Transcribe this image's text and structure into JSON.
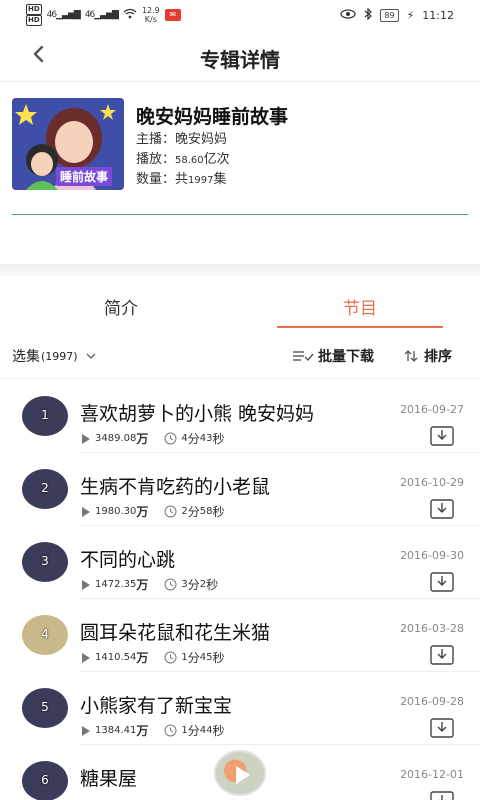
{
  "status_bar": {
    "hd1": "HD",
    "hd2": "HD",
    "signal1": "46",
    "signal2": "46",
    "net_speed": "12.9",
    "net_unit": "K/s",
    "battery": "89",
    "time": "11:12"
  },
  "header": {
    "title": "专辑详情"
  },
  "album": {
    "title": "晚安妈妈睡前故事",
    "cover_label": "睡前故事",
    "host_label": "主播：",
    "host": "晚安妈妈",
    "plays_label": "播放：",
    "plays_num": "58.60",
    "plays_unit": "亿次",
    "count_label": "数量：共",
    "count_num": "1997",
    "count_unit": "集"
  },
  "tabs": {
    "intro": "简介",
    "programs": "节目"
  },
  "toolbar": {
    "select_label": "选集",
    "select_count": "(1997)",
    "batch_label": "批量下载",
    "sort_label": "排序"
  },
  "episodes": [
    {
      "index": "1",
      "title": "喜欢胡萝卜的小熊 晚安妈妈",
      "date": "2016-09-27",
      "plays_num": "3489.08",
      "plays_unit": "万",
      "dur_min": "4",
      "dur_min_unit": "分",
      "dur_sec": "43",
      "dur_sec_unit": "秒"
    },
    {
      "index": "2",
      "title": "生病不肯吃药的小老鼠",
      "date": "2016-10-29",
      "plays_num": "1980.30",
      "plays_unit": "万",
      "dur_min": "2",
      "dur_min_unit": "分",
      "dur_sec": "58",
      "dur_sec_unit": "秒"
    },
    {
      "index": "3",
      "title": "不同的心跳",
      "date": "2016-09-30",
      "plays_num": "1472.35",
      "plays_unit": "万",
      "dur_min": "3",
      "dur_min_unit": "分",
      "dur_sec": "2",
      "dur_sec_unit": "秒"
    },
    {
      "index": "4",
      "title": "圆耳朵花鼠和花生米猫",
      "date": "2016-03-28",
      "plays_num": "1410.54",
      "plays_unit": "万",
      "dur_min": "1",
      "dur_min_unit": "分",
      "dur_sec": "45",
      "dur_sec_unit": "秒"
    },
    {
      "index": "5",
      "title": "小熊家有了新宝宝",
      "date": "2016-09-28",
      "plays_num": "1384.41",
      "plays_unit": "万",
      "dur_min": "1",
      "dur_min_unit": "分",
      "dur_sec": "44",
      "dur_sec_unit": "秒"
    },
    {
      "index": "6",
      "title": "糖果屋",
      "date": "2016-12-01",
      "plays_num": "",
      "plays_unit": "",
      "dur_min": "",
      "dur_min_unit": "",
      "dur_sec": "",
      "dur_sec_unit": ""
    }
  ],
  "colors": {
    "accent": "#e8704d",
    "divider": "#4a9a8f"
  }
}
